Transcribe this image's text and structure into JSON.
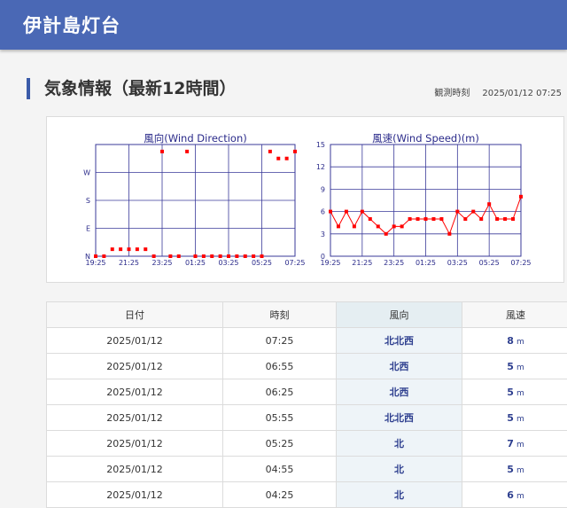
{
  "header": {
    "title": "伊計島灯台"
  },
  "section": {
    "title": "気象情報（最新12時間）",
    "obs_label": "観測時刻",
    "obs_value": "2025/01/12 07:25"
  },
  "chart_data": [
    {
      "type": "scatter",
      "title": "風向(Wind Direction)",
      "x": [
        "19:25",
        "19:55",
        "20:25",
        "20:55",
        "21:25",
        "21:55",
        "22:25",
        "22:55",
        "23:25",
        "23:55",
        "00:25",
        "00:55",
        "01:25",
        "01:55",
        "02:25",
        "02:55",
        "03:25",
        "03:55",
        "04:25",
        "04:55",
        "05:25",
        "05:55",
        "06:25",
        "06:55",
        "07:25"
      ],
      "x_ticks": [
        "19:25",
        "21:25",
        "23:25",
        "01:25",
        "03:25",
        "05:25",
        "07:25"
      ],
      "y_ticks": [
        "N",
        "E",
        "S",
        "W"
      ],
      "y_range": [
        0,
        360
      ],
      "series": [
        {
          "values": [
            0,
            0,
            22.5,
            22.5,
            22.5,
            22.5,
            22.5,
            0,
            337.5,
            0,
            0,
            337.5,
            0,
            0,
            0,
            0,
            0,
            0,
            0,
            0,
            0,
            337.5,
            315,
            315,
            337.5
          ]
        }
      ],
      "color": "#ff0000",
      "grid": true
    },
    {
      "type": "line",
      "title": "風速(Wind Speed)(m)",
      "x": [
        "19:25",
        "19:55",
        "20:25",
        "20:55",
        "21:25",
        "21:55",
        "22:25",
        "22:55",
        "23:25",
        "23:55",
        "00:25",
        "00:55",
        "01:25",
        "01:55",
        "02:25",
        "02:55",
        "03:25",
        "03:55",
        "04:25",
        "04:55",
        "05:25",
        "05:55",
        "06:25",
        "06:55",
        "07:25"
      ],
      "x_ticks": [
        "19:25",
        "21:25",
        "23:25",
        "01:25",
        "03:25",
        "05:25",
        "07:25"
      ],
      "y_ticks": [
        "0",
        "3",
        "6",
        "9",
        "12",
        "15"
      ],
      "ylim": [
        0,
        15
      ],
      "series": [
        {
          "values": [
            6,
            4,
            6,
            4,
            6,
            5,
            4,
            3,
            4,
            4,
            5,
            5,
            5,
            5,
            5,
            3,
            6,
            5,
            6,
            5,
            7,
            5,
            5,
            5,
            8
          ]
        }
      ],
      "color": "#ff0000",
      "grid": true
    }
  ],
  "table": {
    "headers": [
      "日付",
      "時刻",
      "風向",
      "風速"
    ],
    "unit": "m",
    "rows": [
      {
        "date": "2025/01/12",
        "time": "07:25",
        "dir": "北北西",
        "speed": "8"
      },
      {
        "date": "2025/01/12",
        "time": "06:55",
        "dir": "北西",
        "speed": "5"
      },
      {
        "date": "2025/01/12",
        "time": "06:25",
        "dir": "北西",
        "speed": "5"
      },
      {
        "date": "2025/01/12",
        "time": "05:55",
        "dir": "北北西",
        "speed": "5"
      },
      {
        "date": "2025/01/12",
        "time": "05:25",
        "dir": "北",
        "speed": "7"
      },
      {
        "date": "2025/01/12",
        "time": "04:55",
        "dir": "北",
        "speed": "5"
      },
      {
        "date": "2025/01/12",
        "time": "04:25",
        "dir": "北",
        "speed": "6"
      }
    ]
  }
}
